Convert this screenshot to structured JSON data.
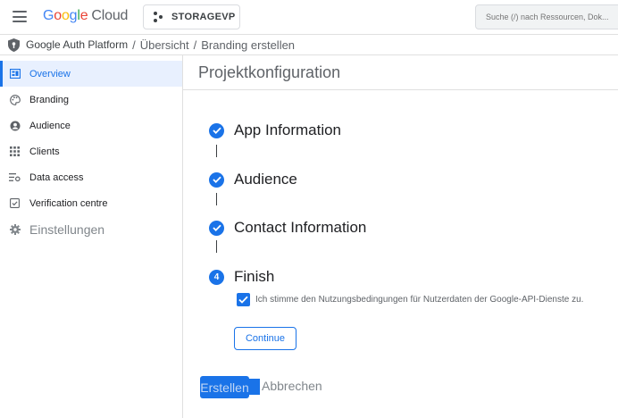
{
  "header": {
    "logo": {
      "g": "G",
      "o1": "o",
      "o2": "o",
      "g2": "g",
      "l": "l",
      "e": "e",
      "cloud": "Cloud"
    },
    "project": "STORAGEVP",
    "search_placeholder": "Suche (/) nach Ressourcen, Dok..."
  },
  "breadcrumb": {
    "product": "Google Auth Platform",
    "separator": "/",
    "items": [
      "Übersicht",
      "Branding erstellen"
    ]
  },
  "sidebar": {
    "items": [
      {
        "label": "Overview",
        "icon": "dashboard-icon",
        "active": true
      },
      {
        "label": "Branding",
        "icon": "palette-icon",
        "active": false
      },
      {
        "label": "Audience",
        "icon": "person-icon",
        "active": false
      },
      {
        "label": "Clients",
        "icon": "apps-grid-icon",
        "active": false
      },
      {
        "label": "Data access",
        "icon": "data-access-icon",
        "active": false
      },
      {
        "label": "Verification centre",
        "icon": "verified-icon",
        "active": false
      },
      {
        "label": "Einstellungen",
        "icon": "gear-icon",
        "active": false
      }
    ]
  },
  "main": {
    "title": "Projektkonfiguration",
    "steps": [
      {
        "title": "App Information",
        "status": "complete"
      },
      {
        "title": "Audience",
        "status": "complete"
      },
      {
        "title": "Contact Information",
        "status": "complete"
      },
      {
        "title": "Finish",
        "status": "current",
        "number": "4"
      }
    ],
    "terms_checkbox": {
      "checked": true,
      "label": "Ich stimme den Nutzungsbedingungen für Nutzerdaten der Google-API-Dienste zu."
    },
    "continue_label": "Continue",
    "create_label": "Erstellen",
    "cancel_label": "Abbrechen"
  },
  "colors": {
    "accent": "#1a73e8",
    "active_bg": "#e8f0fe",
    "text": "#202124",
    "muted": "#5f6368"
  }
}
